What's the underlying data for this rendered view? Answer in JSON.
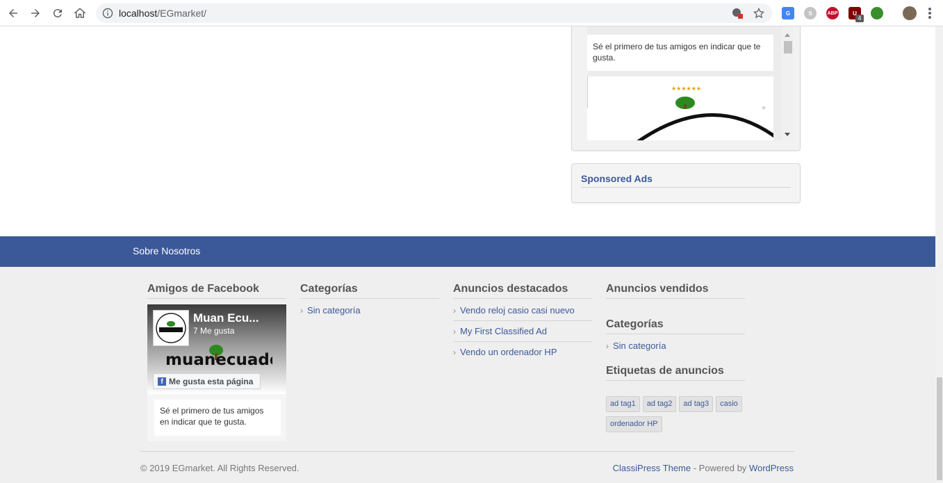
{
  "browser": {
    "url_host": "localhost",
    "url_path": "/EGmarket/",
    "extensions": [
      {
        "name": "google-translate-icon",
        "label": "G",
        "color": "#4285f4"
      },
      {
        "name": "skype-icon",
        "label": "S",
        "color": "#b8b8b8"
      },
      {
        "name": "adblock-plus-icon",
        "label": "ABP",
        "color": "#c70d2c"
      },
      {
        "name": "ublock-icon",
        "label": "U",
        "color": "#800000"
      },
      {
        "name": "globe-extension-icon",
        "label": "",
        "color": "#3a8d2d"
      },
      {
        "name": "profile-avatar-icon",
        "label": "",
        "color": "#7a6a55"
      }
    ],
    "ublock_badge": "4"
  },
  "sidebar": {
    "facebook_like_text": "Sé el primero de tus amigos en indicar que te gusta.",
    "sponsored_title": "Sponsored Ads"
  },
  "footer_bar": {
    "link": "Sobre Nosotros"
  },
  "footer": {
    "facebook": {
      "title": "Amigos de Facebook",
      "page_name": "Muan Ecu...",
      "likes": "7 Me gusta",
      "like_button": "Me gusta esta página",
      "like_text": "Sé el primero de tus amigos en indicar que te gusta.",
      "cover_logo": "muanecuador"
    },
    "categories": {
      "title": "Categorías",
      "items": [
        "Sin categoría"
      ]
    },
    "featured": {
      "title": "Anuncios destacados",
      "items": [
        "Vendo reloj casio casi nuevo",
        "My First Classified Ad",
        "Vendo un ordenador HP"
      ]
    },
    "sold": {
      "title": "Anuncios vendidos"
    },
    "categories2": {
      "title": "Categorías",
      "items": [
        "Sin categoría"
      ]
    },
    "tags": {
      "title": "Etiquetas de anuncios",
      "items": [
        "ad tag1",
        "ad tag2",
        "ad tag3",
        "casio",
        "ordenador HP"
      ]
    },
    "copyright": "© 2019 EGmarket. All Rights Reserved.",
    "credits_theme": "ClassiPress Theme",
    "credits_mid": " - Powered by ",
    "credits_wp": "WordPress"
  }
}
